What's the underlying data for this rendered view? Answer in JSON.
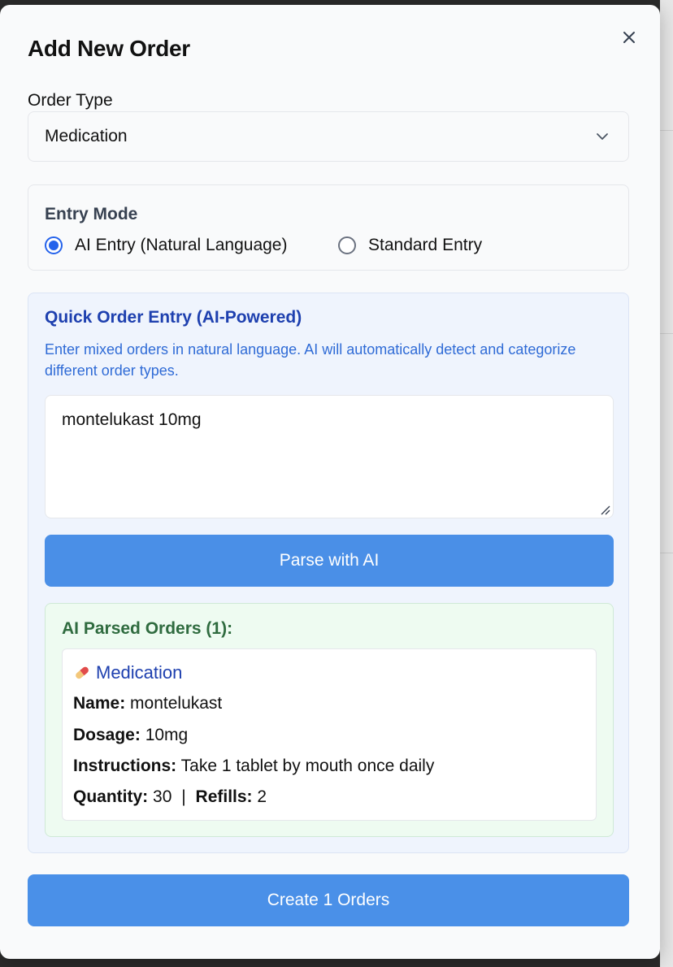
{
  "modal": {
    "title": "Add New Order"
  },
  "order_type": {
    "label": "Order Type",
    "selected": "Medication"
  },
  "entry_mode": {
    "title": "Entry Mode",
    "options": [
      {
        "label": "AI Entry (Natural Language)",
        "checked": true
      },
      {
        "label": "Standard Entry",
        "checked": false
      }
    ]
  },
  "ai_panel": {
    "title": "Quick Order Entry (AI-Powered)",
    "description": "Enter mixed orders in natural language. AI will automatically detect and categorize different order types.",
    "input_value": "montelukast 10mg",
    "parse_button": "Parse with AI"
  },
  "parsed": {
    "title": "AI Parsed Orders (1):",
    "orders": [
      {
        "icon": "pill-icon",
        "category": "Medication",
        "name_label": "Name:",
        "name": "montelukast",
        "dosage_label": "Dosage:",
        "dosage": "10mg",
        "instructions_label": "Instructions:",
        "instructions": "Take 1 tablet by mouth once daily",
        "quantity_label": "Quantity:",
        "quantity": "30",
        "separator": "|",
        "refills_label": "Refills:",
        "refills": "2"
      }
    ]
  },
  "footer": {
    "create_button": "Create 1 Orders"
  },
  "colors": {
    "primary_button": "#4a90e8",
    "ai_title": "#1e40af",
    "parsed_title": "#2f6b3f",
    "radio_checked": "#2563eb"
  }
}
